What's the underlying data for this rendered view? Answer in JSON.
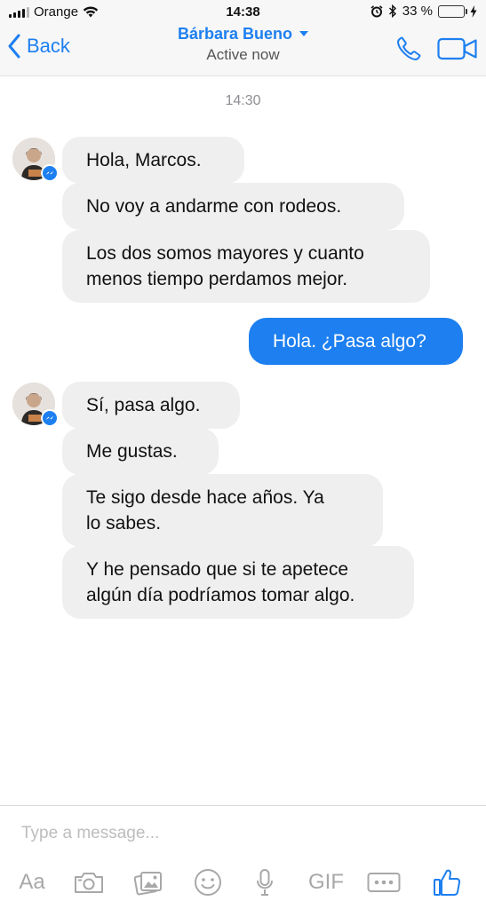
{
  "status_bar": {
    "carrier": "Orange",
    "time": "14:38",
    "battery_percent": "33 %",
    "battery_level": 0.33
  },
  "header": {
    "back_label": "Back",
    "contact_name": "Bárbara Bueno",
    "status": "Active now",
    "accent_color": "#1d7ff0"
  },
  "conversation": {
    "timestamp": "14:30",
    "group1": [
      "Hola, Marcos.",
      "No voy a andarme con rodeos.",
      "Los dos somos mayores y cuanto",
      "menos tiempo perdamos mejor."
    ],
    "outgoing": "Hola. ¿Pasa algo?",
    "group2": [
      "Sí, pasa algo.",
      "Me gustas.",
      "Te sigo desde hace años. Ya",
      "lo sabes.",
      "Y he pensado que si te apetece",
      "algún día podríamos tomar algo."
    ]
  },
  "composer": {
    "placeholder": "Type a message...",
    "tools": {
      "text_label": "Aa",
      "gif_label": "GIF",
      "icons": [
        "camera-icon",
        "gallery-icon",
        "emoji-icon",
        "microphone-icon",
        "more-icon",
        "like-icon"
      ]
    }
  }
}
